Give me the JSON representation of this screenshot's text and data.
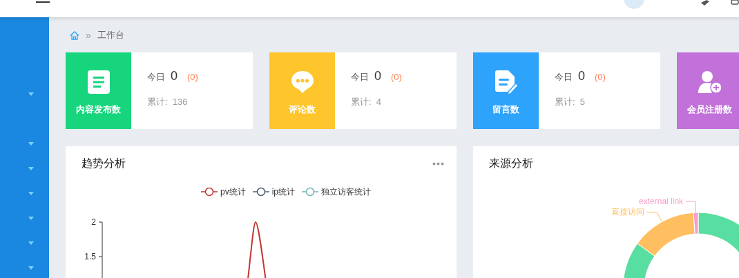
{
  "sidebar": {
    "items": [
      {
        "expanded": false
      },
      {
        "expanded": false
      },
      {
        "expanded": false
      },
      {
        "expanded": false
      },
      {
        "expanded": false
      },
      {
        "expanded": false
      },
      {
        "expanded": false
      }
    ]
  },
  "breadcrumb": {
    "separator": "»",
    "items": [
      "工作台"
    ]
  },
  "stat_cards": [
    {
      "kind": "doc",
      "label": "内容发布数",
      "color": "#17d57d",
      "today_label": "今日",
      "today": "0",
      "today_delta": "(0)",
      "total": "累计:  136"
    },
    {
      "kind": "chat",
      "label": "评论数",
      "color": "#fec52c",
      "today_label": "今日",
      "today": "0",
      "today_delta": "(0)",
      "total": "累计:  4"
    },
    {
      "kind": "note",
      "label": "留言数",
      "color": "#2ea3fb",
      "today_label": "今日",
      "today": "0",
      "today_delta": "(0)",
      "total": "累计:  5"
    },
    {
      "kind": "user",
      "label": "会员注册数",
      "color": "#c171d9"
    }
  ],
  "panels": [
    {
      "title": "趋势分析",
      "legend": [
        {
          "name": "pv统计",
          "color": "#c23531"
        },
        {
          "name": "ip统计",
          "color": "#4b5f75"
        },
        {
          "name": "独立访客统计",
          "color": "#71b4bd"
        }
      ],
      "y_axis_labels": [
        "2",
        "1.5"
      ]
    },
    {
      "title": "来源分析",
      "chart_data": {
        "type": "donut",
        "categories": [
          null,
          "直接访问",
          "external link"
        ],
        "values": [
          85,
          14,
          1
        ],
        "colors": [
          "#58dea0",
          "#ffbe5f",
          "#f99dcc"
        ]
      }
    }
  ]
}
